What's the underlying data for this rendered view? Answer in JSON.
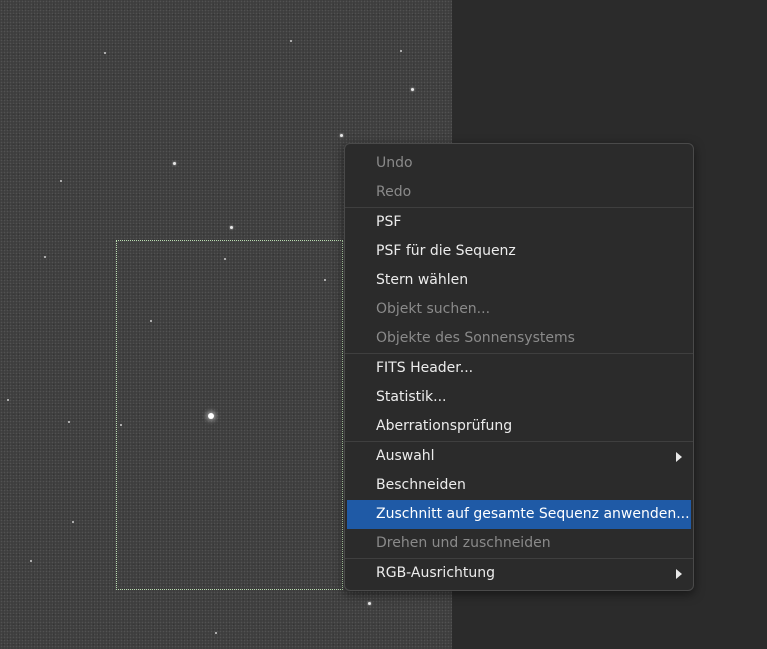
{
  "menu": {
    "items": [
      {
        "label": "Undo"
      },
      {
        "label": "Redo"
      },
      {
        "label": "PSF"
      },
      {
        "label": "PSF für die Sequenz"
      },
      {
        "label": "Stern wählen"
      },
      {
        "label": "Objekt suchen..."
      },
      {
        "label": "Objekte des Sonnensystems"
      },
      {
        "label": "FITS Header..."
      },
      {
        "label": "Statistik..."
      },
      {
        "label": "Aberrationsprüfung"
      },
      {
        "label": "Auswahl"
      },
      {
        "label": "Beschneiden"
      },
      {
        "label": "Zuschnitt auf gesamte Sequenz anwenden..."
      },
      {
        "label": "Drehen und zuschneiden"
      },
      {
        "label": "RGB-Ausrichtung"
      }
    ]
  },
  "colors": {
    "highlight": "#1f5aa6",
    "selection_border": "#b9dcb0",
    "disabled_text": "#8a8a8a"
  }
}
